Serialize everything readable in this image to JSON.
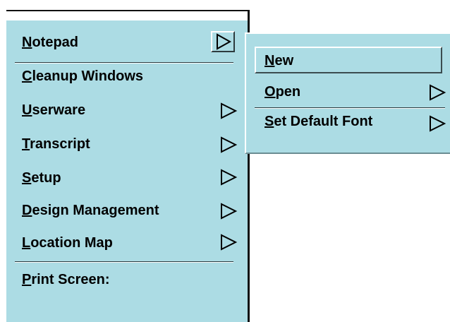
{
  "main_menu": {
    "items": [
      {
        "mnemonic": "N",
        "rest": "otepad",
        "has_submenu": true
      },
      {
        "mnemonic": "C",
        "rest": "leanup Windows",
        "has_submenu": false
      },
      {
        "mnemonic": "U",
        "rest": "serware",
        "has_submenu": true
      },
      {
        "mnemonic": "T",
        "rest": "ranscript",
        "has_submenu": true
      },
      {
        "mnemonic": "S",
        "rest": "etup",
        "has_submenu": true
      },
      {
        "mnemonic": "D",
        "rest": "esign Management",
        "has_submenu": true
      },
      {
        "mnemonic": "L",
        "rest": "ocation Map",
        "has_submenu": true
      },
      {
        "mnemonic": "P",
        "rest": "rint Screen:",
        "has_submenu": false
      }
    ]
  },
  "sub_menu": {
    "items": [
      {
        "mnemonic": "N",
        "rest": "ew",
        "has_submenu": false
      },
      {
        "mnemonic": "O",
        "rest": "pen",
        "has_submenu": true
      },
      {
        "mnemonic": "S",
        "rest": "et Default Font",
        "has_submenu": true
      }
    ]
  },
  "colors": {
    "menu_bg": "#acdce4",
    "arrow": "#000000"
  }
}
